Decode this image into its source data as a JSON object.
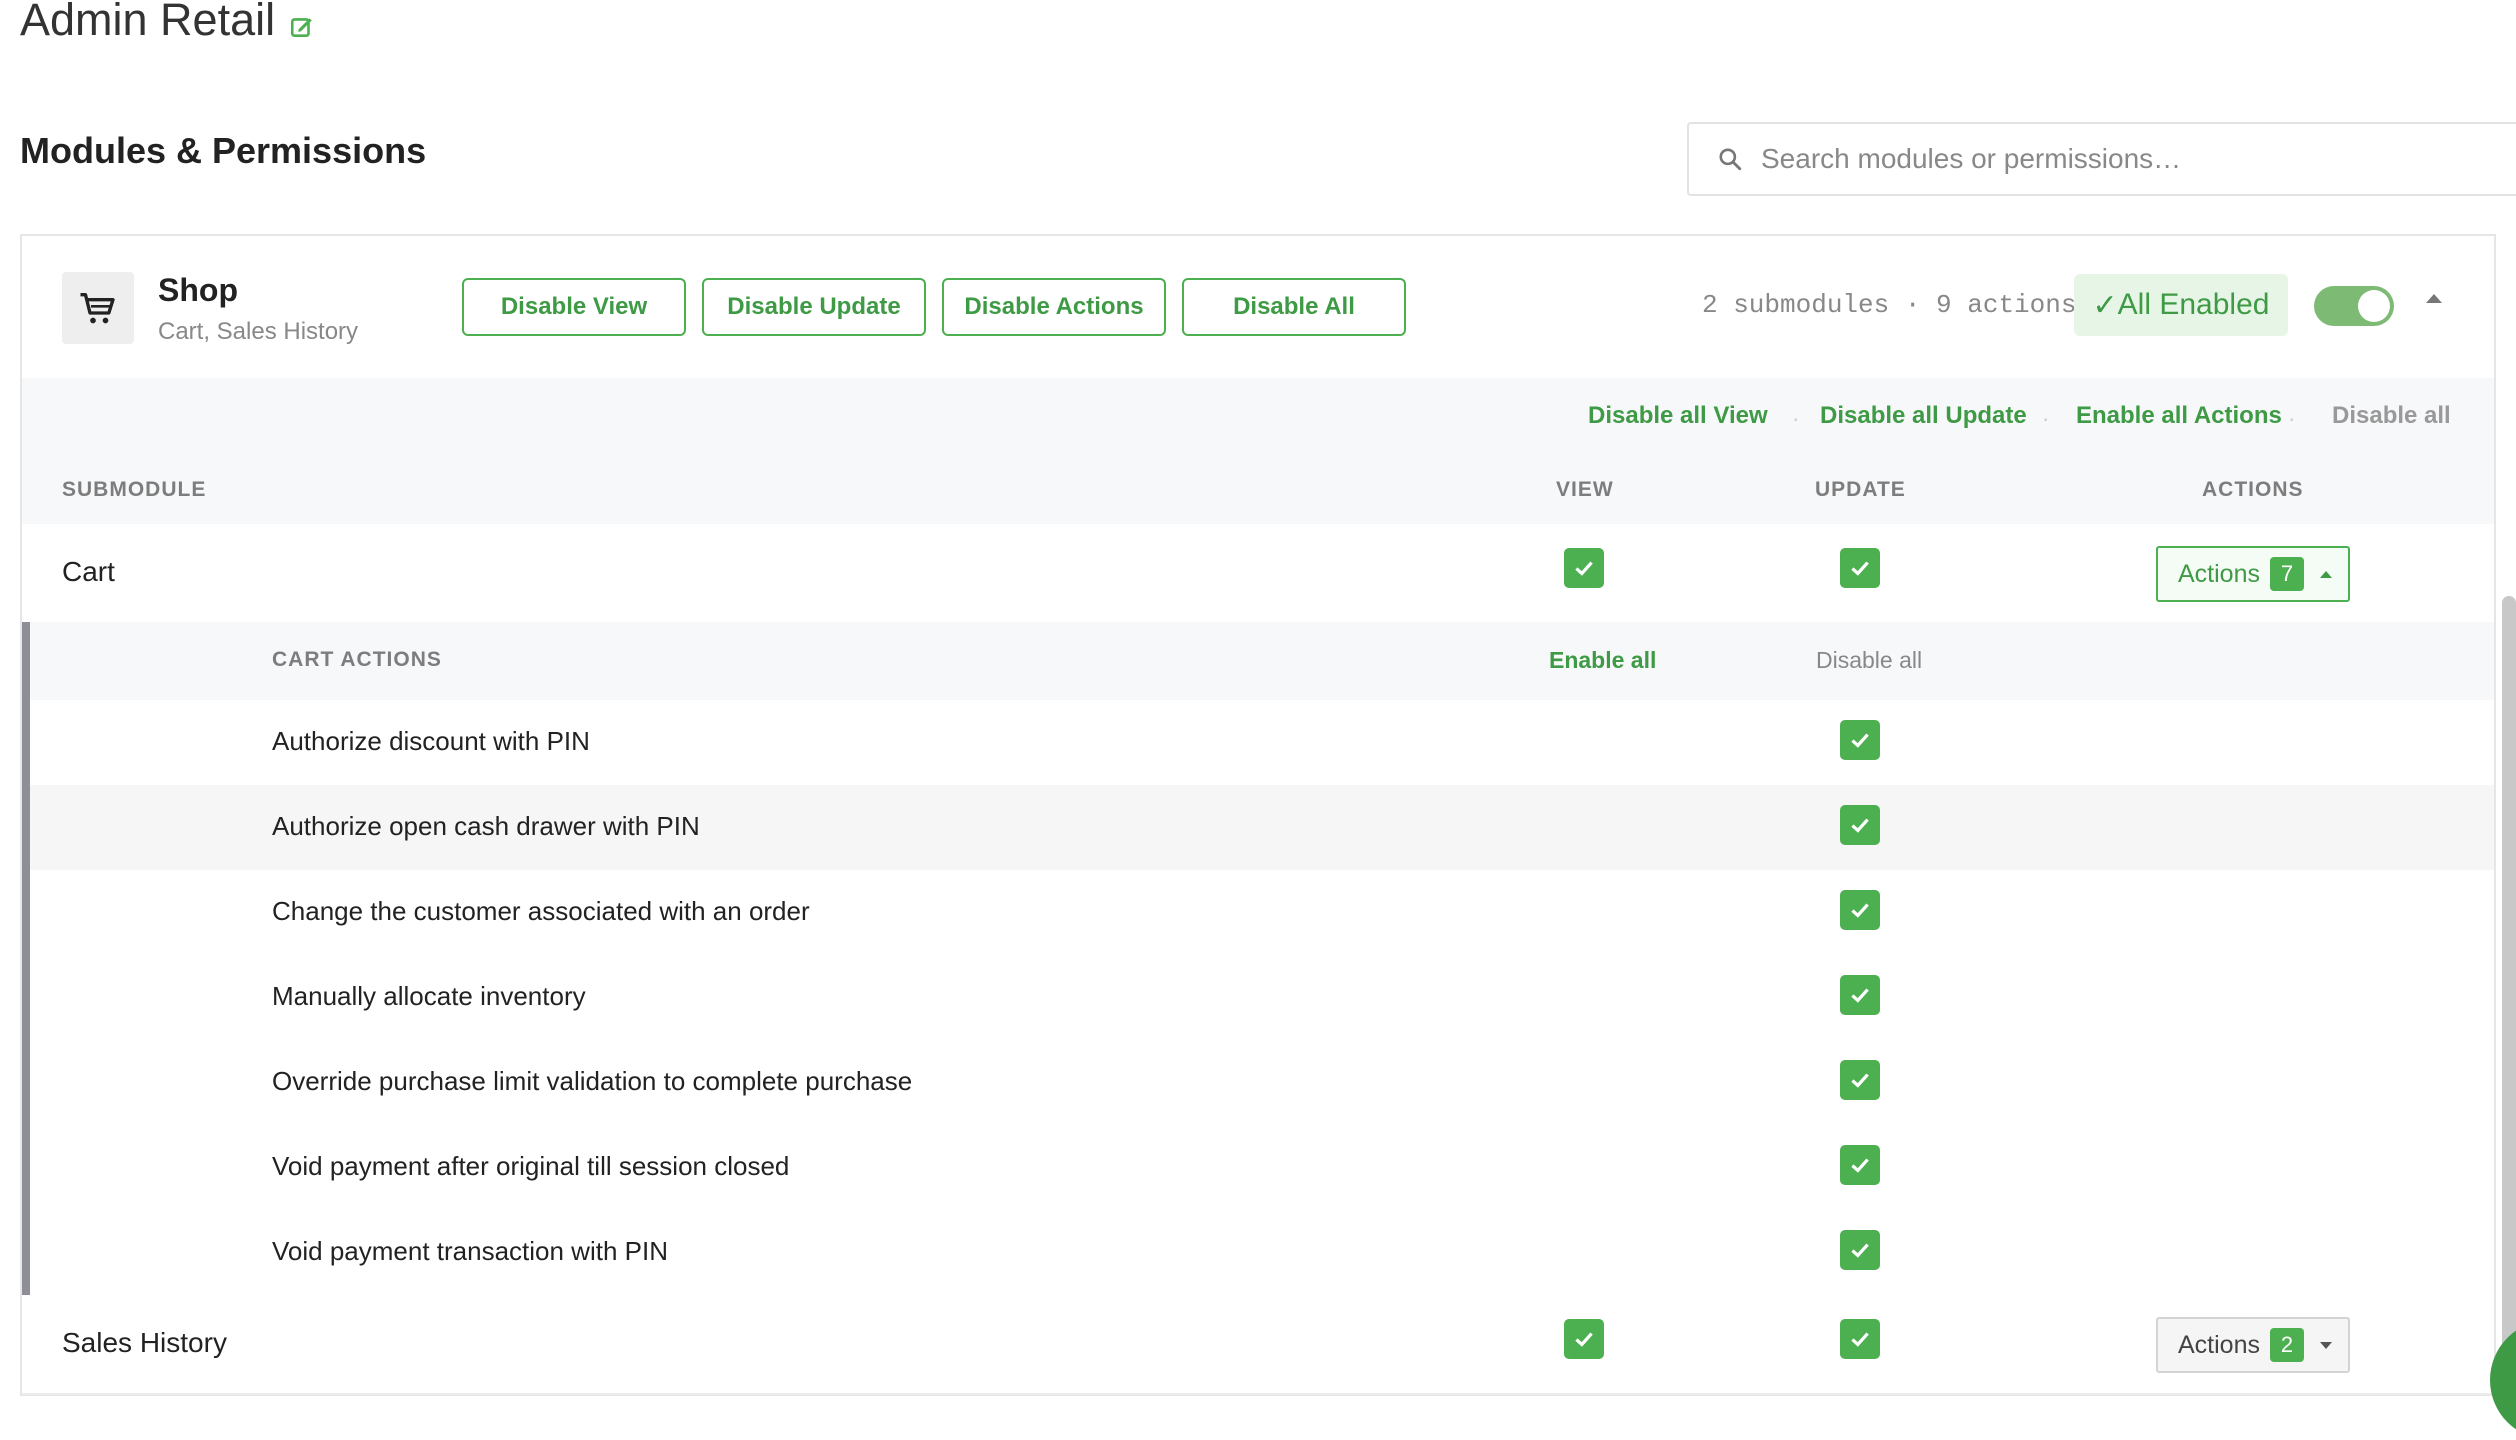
{
  "page": {
    "title": "Admin Retail",
    "section_title": "Modules & Permissions",
    "search_placeholder": "Search modules or permissions…"
  },
  "module": {
    "name": "Shop",
    "subtitle": "Cart, Sales History",
    "icon": "cart-icon",
    "buttons": {
      "disable_view": "Disable View",
      "disable_update": "Disable Update",
      "disable_actions": "Disable Actions",
      "disable_all": "Disable All"
    },
    "counts": "2 submodules · 9 actions",
    "status": "All Enabled",
    "toggle_on": true
  },
  "bulk": {
    "disable_all_view": "Disable all View",
    "disable_all_update": "Disable all Update",
    "enable_all_actions": "Enable all Actions",
    "disable_all": "Disable all"
  },
  "columns": {
    "submodule": "SUBMODULE",
    "view": "VIEW",
    "update": "UPDATE",
    "actions": "ACTIONS"
  },
  "submodules": [
    {
      "name": "Cart",
      "view": true,
      "update": true,
      "actions_label": "Actions",
      "actions_count": "7",
      "expanded": true
    },
    {
      "name": "Sales History",
      "view": true,
      "update": true,
      "actions_label": "Actions",
      "actions_count": "2",
      "expanded": false
    }
  ],
  "cart_actions": {
    "header": "CART ACTIONS",
    "enable_all": "Enable all",
    "disable_all": "Disable all",
    "items": [
      {
        "label": "Authorize discount with PIN",
        "enabled": true
      },
      {
        "label": "Authorize open cash drawer with PIN",
        "enabled": true
      },
      {
        "label": "Change the customer associated with an order",
        "enabled": true
      },
      {
        "label": "Manually allocate inventory",
        "enabled": true
      },
      {
        "label": "Override purchase limit validation to complete purchase",
        "enabled": true
      },
      {
        "label": "Void payment after original till session closed",
        "enabled": true
      },
      {
        "label": "Void payment transaction with PIN",
        "enabled": true
      }
    ]
  },
  "colors": {
    "accent": "#4caf50",
    "accent_text": "#3e9a45",
    "muted": "#888888"
  }
}
